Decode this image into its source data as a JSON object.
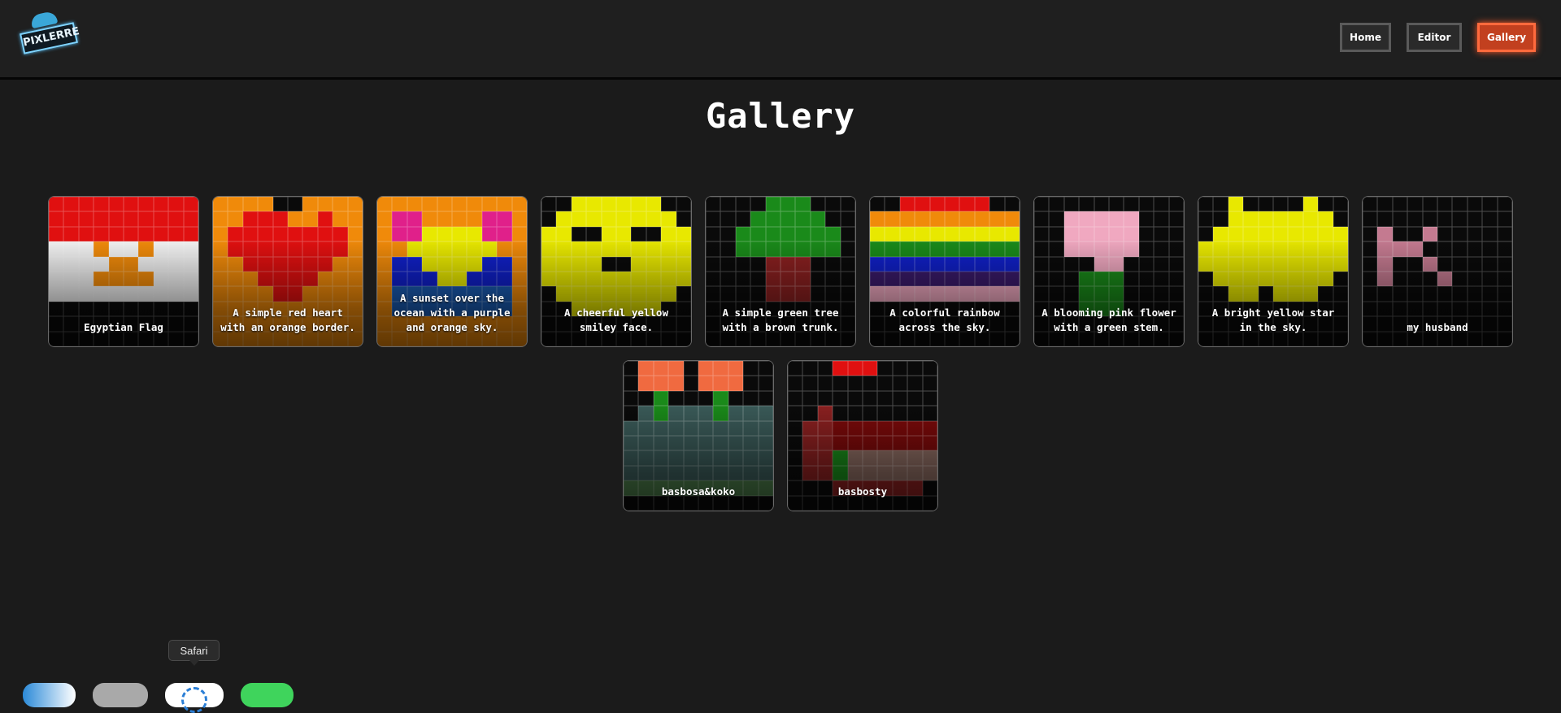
{
  "app": {
    "logo_text": "PIXLERRE"
  },
  "nav": [
    {
      "label": "Home",
      "active": false
    },
    {
      "label": "Editor",
      "active": false
    },
    {
      "label": "Gallery",
      "active": true
    }
  ],
  "page": {
    "title": "Gallery"
  },
  "gallery": [
    {
      "caption": "Egyptian Flag",
      "pixels": [
        "RRRRRRRRRR",
        "RRRRRRRRRR",
        "RRRRRRRRRR",
        "WWWOWWOWWW",
        "WWWWOOWWWW",
        "WWWOOOOWWW",
        "WWWWWWWWWW",
        "KKKKKKKKKK",
        "KKKKKKKKKK",
        "KKKKKKKKKK"
      ]
    },
    {
      "caption": "A simple red heart with an orange border.",
      "pixels": [
        "OOOOKKOOOO",
        "OORRROOROO",
        "ORRRRRRRRO",
        "ORRRRRRRRO",
        "OORRRRRROO",
        "OOORRRROOO",
        "OOOORROOOO",
        "OOOOOOOOOO",
        "OOOOOOOOOO",
        "OOOOOOOOOO"
      ]
    },
    {
      "caption": "A sunset over the ocean with a purple and orange sky.",
      "pixels": [
        "OOOOOOOOOO",
        "OMMOOOOMMO",
        "OMMYYYYMMO",
        "OOYYYYYYOO",
        "OBBYYYYBBO",
        "OBBBYYBBBO",
        "OUUUUUUUUO",
        "OUUUUUUUUO",
        "OOOOOOOOOO",
        "OOOOOOOOOO"
      ]
    },
    {
      "caption": "A cheerful yellow smiley face.",
      "pixels": [
        "KKYYYYYYKK",
        "KYYYYYYYYK",
        "YYKKYYKKYY",
        "YYYYYYYYYY",
        "YYYYKKYYYY",
        "YYYYYYYYYY",
        "KYYYYYYYYK",
        "KKYYYYYYKK",
        "KKKKKKKKKK",
        "KKKKKKKKKK"
      ]
    },
    {
      "caption": "A simple green tree with a brown trunk.",
      "pixels": [
        "KKKKGGGKKK",
        "KKKGGGGGKK",
        "KKGGGGGGGK",
        "KKGGGGGGGK",
        "KKKKNNNKKK",
        "KKKKNNNKKK",
        "KKKKNNNKKK",
        "KKKKKKKKKK",
        "KKKKKKKKKK",
        "KKKKKKKKKK"
      ]
    },
    {
      "caption": "A colorful rainbow across the sky.",
      "pixels": [
        "KKRRRRRRKK",
        "OOOOOOOOOO",
        "YYYYYYYYYY",
        "GGGGGGGGGG",
        "BBBBBBBBBB",
        "VVVVVVVVVV",
        "PPPPPPPPPP",
        "KKKKKKKKKK",
        "KKKKKKKKKK",
        "KKKKKKKKKK"
      ]
    },
    {
      "caption": "A blooming pink flower with a green stem.",
      "pixels": [
        "KKKKKKKKKK",
        "KKPPPPPKKK",
        "KKPPPPPKKK",
        "KKPPPPPKKK",
        "KKKKPPKKKK",
        "KKKGGGKKKK",
        "KKKGGGKKKK",
        "KKKGGGKKKK",
        "KKKKKKKKKK",
        "KKKKKKKKKK"
      ]
    },
    {
      "caption": "A bright yellow star in the sky.",
      "pixels": [
        "KKYKKKKYKK",
        "KKYYYYYYYK",
        "KYYYYYYYYY",
        "YYYYYYYYYY",
        "YYYYYYYYYY",
        "KYYYYYYYYK",
        "KKYYKYYYKK",
        "KKKKKKKKKK",
        "KKKKKKKKKK",
        "KKKKKKKKKK"
      ]
    },
    {
      "caption": "my husband",
      "pixels": [
        "KKKKKKKKKK",
        "KKKKKKKKKK",
        "KLKKLKKKKK",
        "KLLLKKKKKK",
        "KLKKLKKKKK",
        "KLKKKLKKKK",
        "KKKKKKKKKK",
        "KKKKKKKKKK",
        "KKKKKKKKKK",
        "KKKKKKKKKK"
      ]
    },
    {
      "caption": "basbosa&koko",
      "pixels": [
        "KCCCKCCCKK",
        "KCCCKCCCKK",
        "KKGKKKGKKK",
        "KSGSSSGSSS",
        "SSSSSSSSSS",
        "SSSSSSSSSS",
        "SSSSSSSSSS",
        "SSSSSSSSSS",
        "FFFFFFFFFF",
        "KKKKKKKKKK"
      ]
    },
    {
      "caption": "basbosty",
      "pixels": [
        "KKKRRRKKKK",
        "KKKKKKKKKK",
        "KKKKKKKKKK",
        "KKNKKKKKKK",
        "KNNDDDDDDD",
        "KNNDDDDDDD",
        "KNNGXXXXXX",
        "KNNGXXXXXX",
        "KKKNNNNNNK",
        "KKKKKKKKKK"
      ]
    }
  ],
  "palette": {
    "R": "#e01010",
    "W": "#f2f2f2",
    "O": "#f08a0a",
    "K": "#0a0a0a",
    "M": "#e0208a",
    "Y": "#e8e800",
    "B": "#1020c8",
    "U": "#1a5ab0",
    "G": "#1a8a1a",
    "N": "#8a2020",
    "V": "#3a1a6a",
    "P": "#f0a8c0",
    "L": "#c47a90",
    "C": "#f06a40",
    "S": "#3a5a58",
    "F": "#4a7a48",
    "D": "#7a0a0a",
    "X": "#8a6a60"
  },
  "dock": {
    "tooltip": "Safari"
  }
}
